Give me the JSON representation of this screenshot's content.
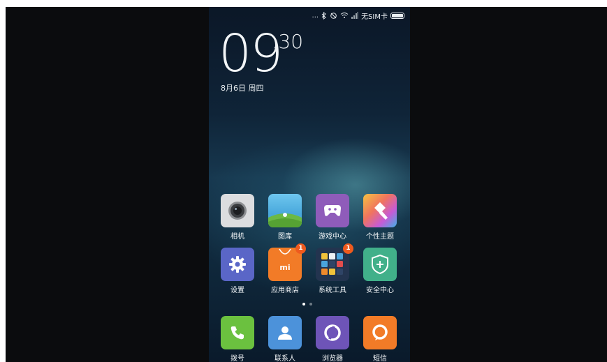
{
  "status_bar": {
    "dots": "...",
    "bluetooth_icon": "bluetooth-icon",
    "sync_icon": "sync-icon",
    "wifi_icon": "wifi-icon",
    "signal_icon": "signal-icon",
    "sim_text": "无SIM卡",
    "battery_icon": "battery-icon"
  },
  "clock": {
    "hour": "09",
    "minute": ":30",
    "date": "8月6日 周四"
  },
  "apps": [
    {
      "label": "相机",
      "icon": "camera-icon",
      "color": "#d8d9db"
    },
    {
      "label": "图库",
      "icon": "gallery-icon",
      "color": "#5cb8e6"
    },
    {
      "label": "游戏中心",
      "icon": "gamepad-icon",
      "color": "#8e5bb8"
    },
    {
      "label": "个性主题",
      "icon": "theme-brush-icon",
      "color": "#f06d6d"
    },
    {
      "label": "设置",
      "icon": "gear-icon",
      "color": "#5865c6"
    },
    {
      "label": "应用商店",
      "icon": "app-store-bag-icon",
      "color": "#f07a26",
      "badge": "1",
      "brand": "mi"
    },
    {
      "label": "系统工具",
      "icon": "folder-icon",
      "color": "#2b3b58",
      "badge": "1"
    },
    {
      "label": "安全中心",
      "icon": "shield-icon",
      "color": "#3fae88"
    }
  ],
  "dock": [
    {
      "label": "拨号",
      "icon": "phone-icon",
      "color": "#69c03e"
    },
    {
      "label": "联系人",
      "icon": "contacts-icon",
      "color": "#4a90d9"
    },
    {
      "label": "浏览器",
      "icon": "browser-icon",
      "color": "#6d53b6"
    },
    {
      "label": "短信",
      "icon": "message-icon",
      "color": "#f07a26"
    }
  ],
  "page_indicator": {
    "pages": 2,
    "current": 1
  }
}
